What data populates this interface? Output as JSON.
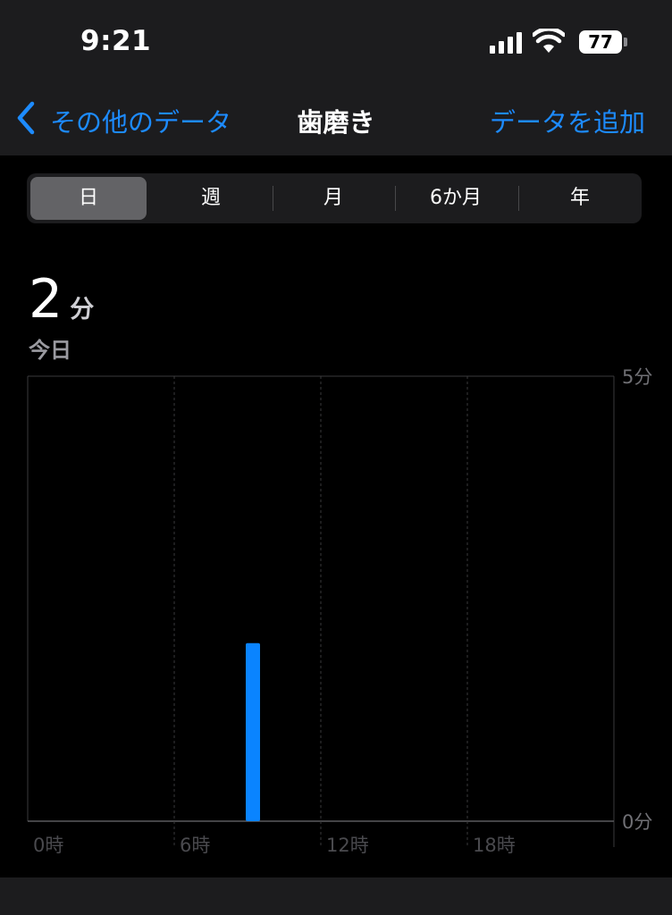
{
  "status_bar": {
    "time": "9:21",
    "battery_level": "77",
    "signal_icon": "cellular-signal-icon",
    "wifi_icon": "wifi-icon"
  },
  "nav": {
    "back_label": "その他のデータ",
    "title": "歯磨き",
    "add_label": "データを追加",
    "accent_color": "#1d8bff"
  },
  "segments": {
    "items": [
      "日",
      "週",
      "月",
      "6か月",
      "年"
    ],
    "selected": "日"
  },
  "summary": {
    "value": "2",
    "unit": "分",
    "period": "今日"
  },
  "chart_data": {
    "type": "bar",
    "x_tick_labels": [
      "0時",
      "6時",
      "12時",
      "18時"
    ],
    "y_tick_labels": [
      "5分",
      "0分"
    ],
    "ylim": [
      0,
      5
    ],
    "xlim": [
      0,
      24
    ],
    "bars": [
      {
        "x": 9,
        "value": 2
      }
    ],
    "bar_color": "#0a84ff",
    "grid": true
  }
}
